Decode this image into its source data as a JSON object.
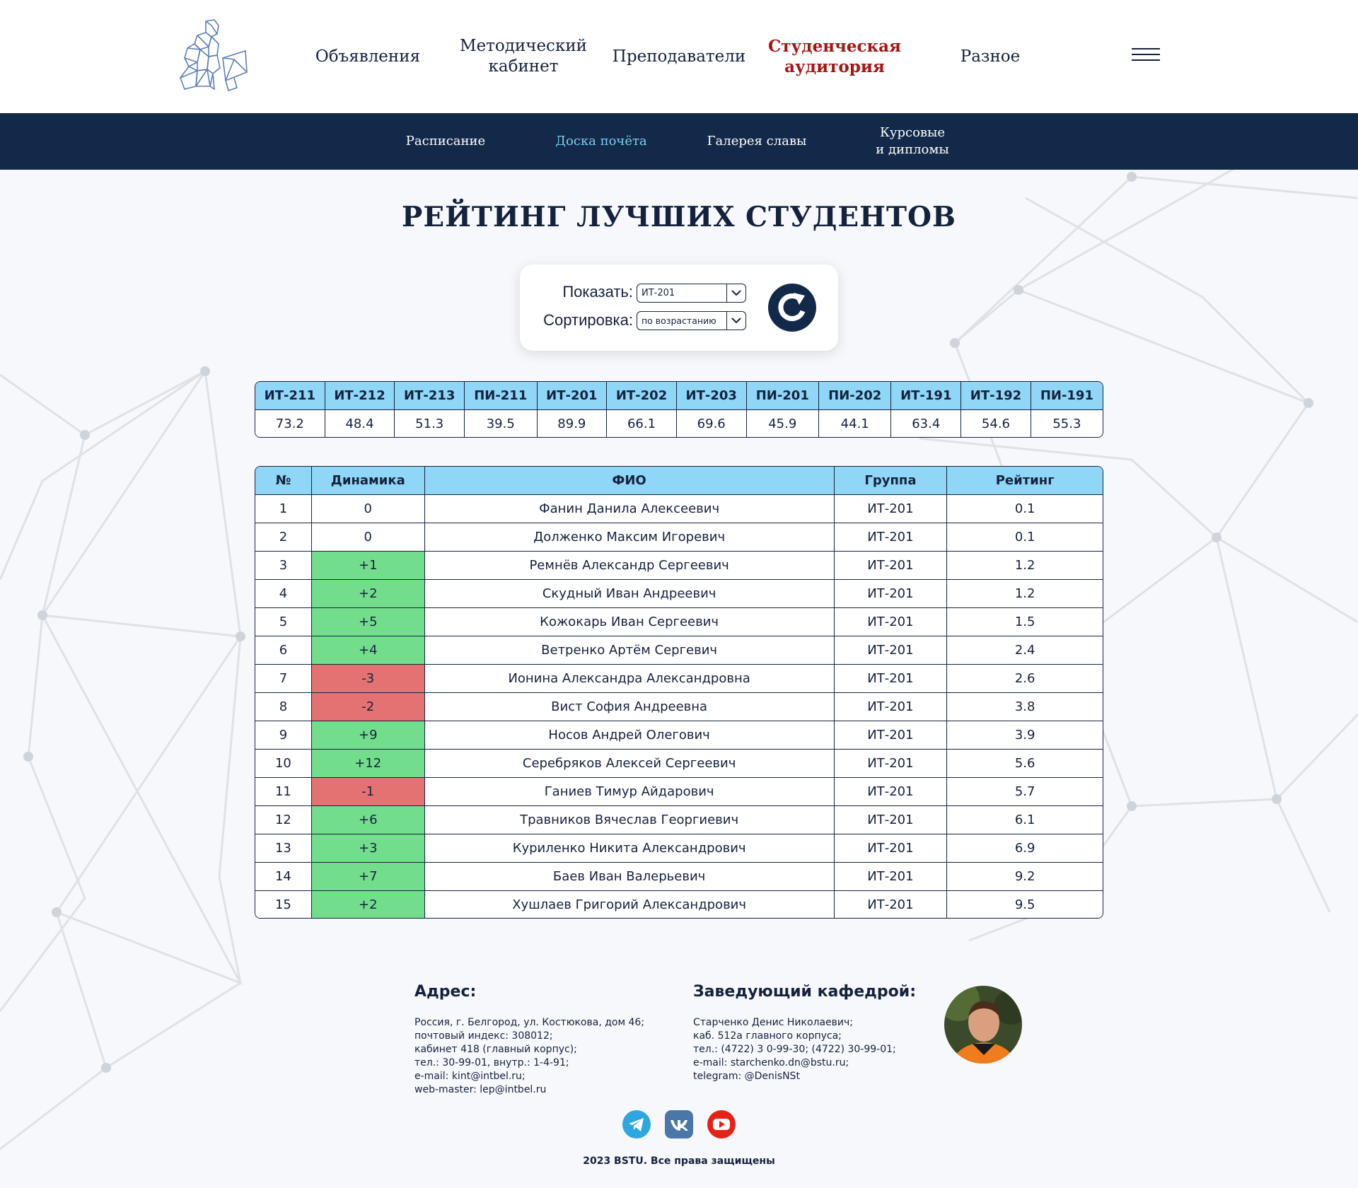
{
  "nav": {
    "items": [
      {
        "label": "Объявления",
        "active": false
      },
      {
        "label": "Методический\nкабинет",
        "active": false
      },
      {
        "label": "Преподаватели",
        "active": false
      },
      {
        "label": "Студенческая\nаудитория",
        "active": true
      },
      {
        "label": "Разное",
        "active": false
      }
    ]
  },
  "subnav": {
    "items": [
      {
        "label": "Расписание",
        "active": false
      },
      {
        "label": "Доска почёта",
        "active": true
      },
      {
        "label": "Галерея славы",
        "active": false
      },
      {
        "label": "Курсовые\nи дипломы",
        "active": false
      }
    ]
  },
  "page": {
    "title": "РЕЙТИНГ ЛУЧШИХ СТУДЕНТОВ"
  },
  "filters": {
    "show_label": "Показать:",
    "show_value": "ИТ-201",
    "sort_label": "Сортировка:",
    "sort_value": "по возрастанию"
  },
  "groups": {
    "names": [
      "ИТ-211",
      "ИТ-212",
      "ИТ-213",
      "ПИ-211",
      "ИТ-201",
      "ИТ-202",
      "ИТ-203",
      "ПИ-201",
      "ПИ-202",
      "ИТ-191",
      "ИТ-192",
      "ПИ-191"
    ],
    "scores": [
      "73.2",
      "48.4",
      "51.3",
      "39.5",
      "89.9",
      "66.1",
      "69.6",
      "45.9",
      "44.1",
      "63.4",
      "54.6",
      "55.3"
    ]
  },
  "rating": {
    "headers": {
      "num": "№",
      "dynamics": "Динамика",
      "name": "ФИО",
      "group": "Группа",
      "rating": "Рейтинг"
    },
    "rows": [
      {
        "num": "1",
        "dynamics": "0",
        "name": "Фанин Данила Алексеевич",
        "group": "ИТ-201",
        "rating": "0.1"
      },
      {
        "num": "2",
        "dynamics": "0",
        "name": "Долженко Максим Игоревич",
        "group": "ИТ-201",
        "rating": "0.1"
      },
      {
        "num": "3",
        "dynamics": "+1",
        "name": "Ремнёв Александр Сергеевич",
        "group": "ИТ-201",
        "rating": "1.2"
      },
      {
        "num": "4",
        "dynamics": "+2",
        "name": "Скудный Иван Андреевич",
        "group": "ИТ-201",
        "rating": "1.2"
      },
      {
        "num": "5",
        "dynamics": "+5",
        "name": "Кожокарь Иван Сергеевич",
        "group": "ИТ-201",
        "rating": "1.5"
      },
      {
        "num": "6",
        "dynamics": "+4",
        "name": "Ветренко Артём Сергевич",
        "group": "ИТ-201",
        "rating": "2.4"
      },
      {
        "num": "7",
        "dynamics": "-3",
        "name": "Ионина Александра Александровна",
        "group": "ИТ-201",
        "rating": "2.6"
      },
      {
        "num": "8",
        "dynamics": "-2",
        "name": "Вист София Андреевна",
        "group": "ИТ-201",
        "rating": "3.8"
      },
      {
        "num": "9",
        "dynamics": "+9",
        "name": "Носов Андрей Олегович",
        "group": "ИТ-201",
        "rating": "3.9"
      },
      {
        "num": "10",
        "dynamics": "+12",
        "name": "Серебряков Алексей Сергеевич",
        "group": "ИТ-201",
        "rating": "5.6"
      },
      {
        "num": "11",
        "dynamics": "-1",
        "name": "Ганиев Тимур Айдарович",
        "group": "ИТ-201",
        "rating": "5.7"
      },
      {
        "num": "12",
        "dynamics": "+6",
        "name": "Травников Вячеслав Георгиевич",
        "group": "ИТ-201",
        "rating": "6.1"
      },
      {
        "num": "13",
        "dynamics": "+3",
        "name": "Куриленко Никита Александрович",
        "group": "ИТ-201",
        "rating": "6.9"
      },
      {
        "num": "14",
        "dynamics": "+7",
        "name": "Баев Иван Валерьевич",
        "group": "ИТ-201",
        "rating": "9.2"
      },
      {
        "num": "15",
        "dynamics": "+2",
        "name": "Хушлаев Григорий Александрович",
        "group": "ИТ-201",
        "rating": "9.5"
      }
    ]
  },
  "footer": {
    "address_title": "Адрес:",
    "address_text": "Россия, г. Белгород, ул. Костюкова, дом 46;\nпочтовый индекс: 308012;\nкабинет 418 (главный корпус);\nтел.: 30-99-01, внутр.: 1-4-91;\ne-mail: kint@intbel.ru;\nweb-master: lep@intbel.ru",
    "head_title": "Заведующий кафедрой:",
    "head_text": "Старченко Денис Николаевич;\nкаб. 512а главного корпуса;\nтел.: (4722) 3 0-99-30; (4722) 30-99-01;\ne-mail: starchenko.dn@bstu.ru;\ntelegram: @DenisNSt",
    "copyright": "2023 BSTU. Все права защищены"
  },
  "colors": {
    "navy": "#13294a",
    "active_red": "#a81414",
    "active_light_blue": "#7ccdf0",
    "table_header": "#8fd6f7",
    "positive": "#72de8c",
    "negative": "#e47272"
  },
  "icons": {
    "logo": "thinker-computer-logo",
    "menu": "burger-menu-icon",
    "refresh": "refresh-icon",
    "social": [
      "telegram-icon",
      "vk-icon",
      "youtube-icon"
    ]
  }
}
